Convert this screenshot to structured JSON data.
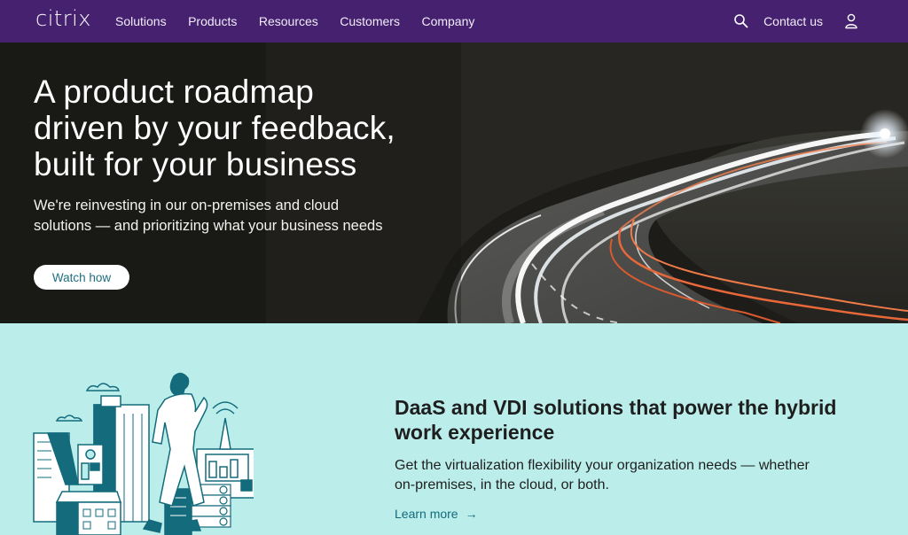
{
  "nav": {
    "logo": "citrix",
    "links": [
      "Solutions",
      "Products",
      "Resources",
      "Customers",
      "Company"
    ],
    "contact_label": "Contact us",
    "search_icon": "search-icon",
    "user_icon": "user-icon"
  },
  "hero": {
    "title_lines": [
      "A product roadmap",
      "driven by your feedback,",
      "built for your business"
    ],
    "subtitle_lines": [
      "We're reinvesting in our on-premises and cloud",
      "solutions — and prioritizing what your business needs"
    ],
    "button_label": "Watch how"
  },
  "feature": {
    "title_lines": [
      "DaaS and VDI solutions that power the hybrid",
      "work experience"
    ],
    "description_lines": [
      "Get the virtualization flexibility your organization needs — whether",
      "on-premises, in the cloud, or both."
    ],
    "link_label": "Learn more",
    "link_icon": "→"
  },
  "colors": {
    "nav_bg": "#452170",
    "feature_bg": "#bbeeeb",
    "accent_teal": "#136b7c"
  }
}
